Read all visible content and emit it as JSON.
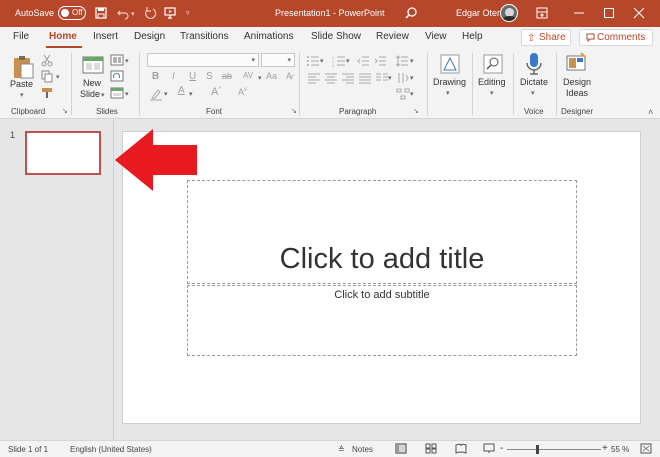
{
  "titlebar": {
    "autosave_label": "AutoSave",
    "autosave_state": "Off",
    "doc_title": "Presentation1 - PowerPoint",
    "user_name": "Edgar Otero",
    "accent_color": "#b7472a"
  },
  "tabs": [
    {
      "label": "File"
    },
    {
      "label": "Home"
    },
    {
      "label": "Insert"
    },
    {
      "label": "Design"
    },
    {
      "label": "Transitions"
    },
    {
      "label": "Animations"
    },
    {
      "label": "Slide Show"
    },
    {
      "label": "Review"
    },
    {
      "label": "View"
    },
    {
      "label": "Help"
    }
  ],
  "active_tab": "Home",
  "share_label": "Share",
  "comments_label": "Comments",
  "ribbon": {
    "paste_label": "Paste",
    "new_slide_label_1": "New",
    "new_slide_label_2": "Slide",
    "drawing_label": "Drawing",
    "editing_label": "Editing",
    "dictate_label": "Dictate",
    "design_ideas_label_1": "Design",
    "design_ideas_label_2": "Ideas",
    "groups": {
      "clipboard": "Clipboard",
      "slides": "Slides",
      "font": "Font",
      "paragraph": "Paragraph",
      "voice": "Voice",
      "designer": "Designer"
    },
    "font_buttons": [
      "B",
      "I",
      "U",
      "S",
      "ab",
      "AV"
    ]
  },
  "thumbnails": {
    "number": "1"
  },
  "slide": {
    "title_placeholder": "Click to add title",
    "subtitle_placeholder": "Click to add subtitle"
  },
  "statusbar": {
    "slide_info": "Slide 1 of 1",
    "language": "English (United States)",
    "notes_label": "Notes",
    "zoom": "55 %",
    "minus": "-",
    "plus": "+"
  }
}
